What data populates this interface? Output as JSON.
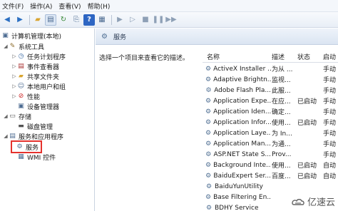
{
  "menu": {
    "items": [
      "文件(F)",
      "操作(A)",
      "查看(V)",
      "帮助(H)"
    ]
  },
  "toolbar": {
    "buttons": [
      "back-icon",
      "forward-icon",
      "folder-up-icon",
      "tree-view-icon",
      "refresh-icon",
      "export-icon",
      "help-icon",
      "properties-icon",
      "play-icon",
      "play-next-icon",
      "stop-icon",
      "pause-icon",
      "restart-icon"
    ]
  },
  "tree": {
    "root": "计算机管理(本地)",
    "system_tools": "系统工具",
    "task_scheduler": "任务计划程序",
    "event_viewer": "事件查看器",
    "shared_folders": "共享文件夹",
    "local_users": "本地用户和组",
    "performance": "性能",
    "device_manager": "设备管理器",
    "storage": "存储",
    "disk_management": "磁盘管理",
    "services_apps": "服务和应用程序",
    "services": "服务",
    "wmi": "WMI 控件"
  },
  "pane": {
    "title": "服务",
    "description_hint": "选择一个项目来查看它的描述。"
  },
  "columns": {
    "name": "名称",
    "description": "描述",
    "state": "状态",
    "startup": "启动"
  },
  "services": [
    {
      "name": "ActiveX Installer ...",
      "desc": "为从 ...",
      "state": "",
      "startup": "手动"
    },
    {
      "name": "Adaptive Brightn...",
      "desc": "监视...",
      "state": "",
      "startup": "手动"
    },
    {
      "name": "Adobe Flash Pla...",
      "desc": "此服...",
      "state": "",
      "startup": "手动"
    },
    {
      "name": "Application Expe...",
      "desc": "在应...",
      "state": "已启动",
      "startup": "手动"
    },
    {
      "name": "Application Iden...",
      "desc": "确定...",
      "state": "",
      "startup": "手动"
    },
    {
      "name": "Application Infor...",
      "desc": "使用...",
      "state": "已启动",
      "startup": "手动"
    },
    {
      "name": "Application Laye...",
      "desc": "为 In...",
      "state": "",
      "startup": "手动"
    },
    {
      "name": "Application Man...",
      "desc": "为通...",
      "state": "",
      "startup": "手动"
    },
    {
      "name": "ASP.NET State S...",
      "desc": "Prov...",
      "state": "",
      "startup": "手动"
    },
    {
      "name": "Background Inte...",
      "desc": "使用...",
      "state": "已启动",
      "startup": "自动"
    },
    {
      "name": "BaiduExpert Ser...",
      "desc": "百度...",
      "state": "已启动",
      "startup": "自动"
    },
    {
      "name": "BaiduYunUtility",
      "desc": "",
      "state": "",
      "startup": ""
    },
    {
      "name": "Base Filtering En...",
      "desc": "",
      "state": "",
      "startup": ""
    },
    {
      "name": "BDHY Service",
      "desc": "",
      "state": "",
      "startup": ""
    }
  ],
  "watermark": {
    "text": "亿速云"
  }
}
